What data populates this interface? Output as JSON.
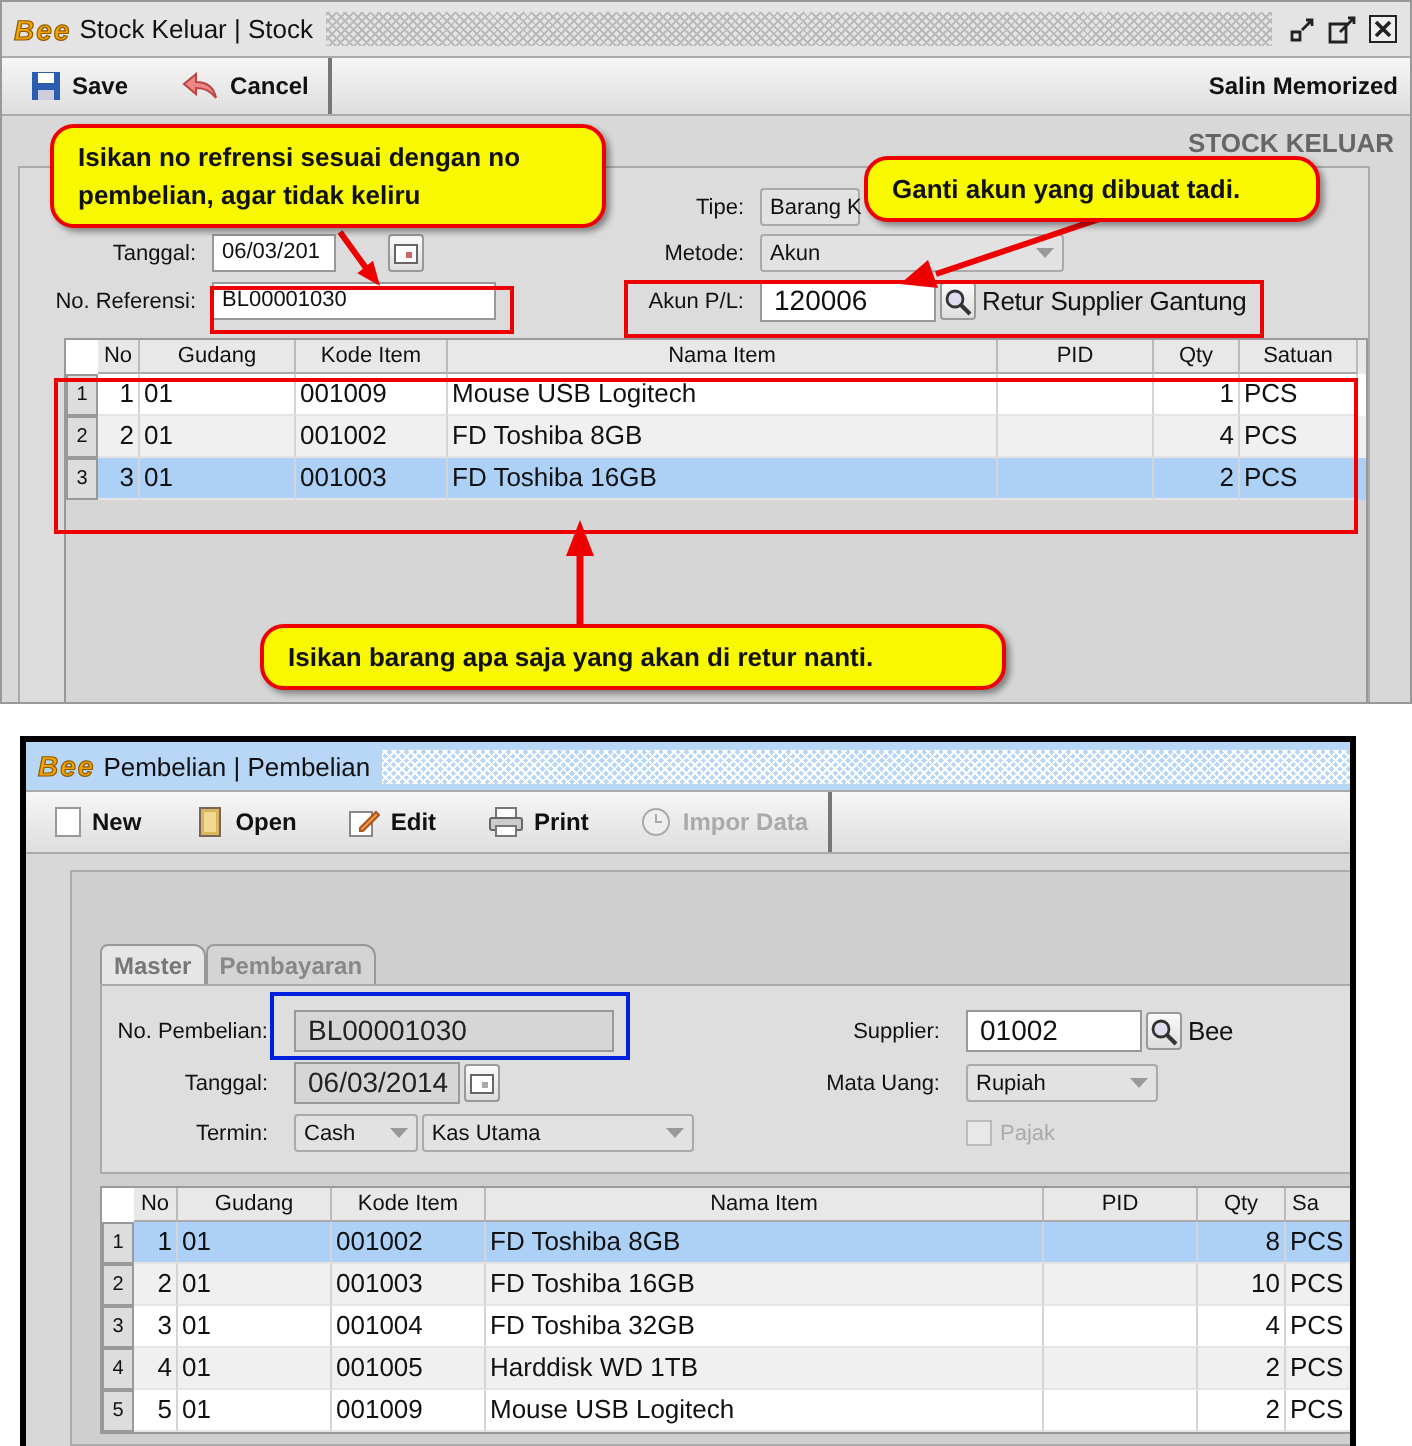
{
  "stock_keluar": {
    "title_bar": {
      "logo": "Bee",
      "title": "Stock Keluar | Stock",
      "active": false
    },
    "toolbar": [
      {
        "label": "Save",
        "disabled": false
      },
      {
        "label": "Cancel",
        "disabled": false
      }
    ],
    "memorized_button": "Salin Memorized",
    "heading": "STOCK KELUAR",
    "form": {
      "tipe": {
        "label": "Tipe:",
        "value": "Barang K"
      },
      "tanggal": {
        "label": "Tanggal:",
        "value": "06/03/201"
      },
      "metode": {
        "label": "Metode:",
        "value": "Akun"
      },
      "no_referensi": {
        "label": "No. Referensi:",
        "value": "BL00001030"
      },
      "akun": {
        "label": "Akun P/L:",
        "value": "120006",
        "name": "Retur Supplier Gantung"
      }
    },
    "table": {
      "columns": [
        "No",
        "Gudang",
        "Kode Item",
        "Nama Item",
        "PID",
        "Qty",
        "Satuan"
      ],
      "rows": [
        {
          "row_number": "1",
          "no": "1",
          "gudang": "01",
          "kode_item": "001009",
          "nama_item": "Mouse USB Logitech",
          "qty": "1",
          "satuan": "PCS",
          "selected": false
        },
        {
          "row_number": "2",
          "no": "2",
          "gudang": "01",
          "kode_item": "001002",
          "nama_item": "FD Toshiba 8GB",
          "qty": "4",
          "satuan": "PCS",
          "selected": false
        },
        {
          "row_number": "3",
          "no": "3",
          "gudang": "01",
          "kode_item": "001003",
          "nama_item": "FD Toshiba 16GB",
          "qty": "2",
          "satuan": "PCS",
          "selected": true
        }
      ]
    }
  },
  "callouts": [
    {
      "text": "Isikan no refrensi sesuai dengan no pembelian, agar tidak keliru"
    },
    {
      "text": "Ganti akun yang dibuat tadi."
    },
    {
      "text": "Isikan barang apa saja yang akan di retur nanti."
    }
  ],
  "pembelian": {
    "title_bar": {
      "logo": "Bee",
      "title": "Pembelian | Pembelian",
      "active": true
    },
    "toolbar": [
      {
        "label": "New",
        "disabled": false
      },
      {
        "label": "Open",
        "disabled": false
      },
      {
        "label": "Edit",
        "disabled": false
      },
      {
        "label": "Print",
        "disabled": false
      },
      {
        "label": "Impor Data",
        "disabled": true
      }
    ],
    "tabs": [
      {
        "label": "Master",
        "selected": true
      },
      {
        "label": "Pembayaran",
        "selected": false
      }
    ],
    "form": {
      "no_pembelian": {
        "label": "No. Pembelian:",
        "value": "BL00001030"
      },
      "tanggal": {
        "label": "Tanggal:",
        "value": "06/03/2014"
      },
      "termin": {
        "label": "Termin:",
        "value": "Cash",
        "account": "Kas Utama"
      },
      "supplier": {
        "label": "Supplier:",
        "value": "01002",
        "name": "Bee"
      },
      "mata_uang": {
        "label": "Mata Uang:",
        "value": "Rupiah"
      },
      "pajak": {
        "label": "Pajak",
        "checked": false,
        "disabled": true
      }
    },
    "table": {
      "columns": [
        "No",
        "Gudang",
        "Kode Item",
        "Nama Item",
        "PID",
        "Qty",
        "Sa"
      ],
      "rows": [
        {
          "row_number": "1",
          "no": "1",
          "gudang": "01",
          "kode_item": "001002",
          "nama_item": "FD Toshiba 8GB",
          "qty": "8",
          "satuan": "PCS",
          "selected": true
        },
        {
          "row_number": "2",
          "no": "2",
          "gudang": "01",
          "kode_item": "001003",
          "nama_item": "FD Toshiba 16GB",
          "qty": "10",
          "satuan": "PCS",
          "selected": false
        },
        {
          "row_number": "3",
          "no": "3",
          "gudang": "01",
          "kode_item": "001004",
          "nama_item": "FD Toshiba 32GB",
          "qty": "4",
          "satuan": "PCS",
          "selected": false
        },
        {
          "row_number": "4",
          "no": "4",
          "gudang": "01",
          "kode_item": "001005",
          "nama_item": "Harddisk WD 1TB",
          "qty": "2",
          "satuan": "PCS",
          "selected": false
        },
        {
          "row_number": "5",
          "no": "5",
          "gudang": "01",
          "kode_item": "001009",
          "nama_item": "Mouse USB Logitech",
          "qty": "2",
          "satuan": "PCS",
          "selected": false
        }
      ]
    }
  }
}
